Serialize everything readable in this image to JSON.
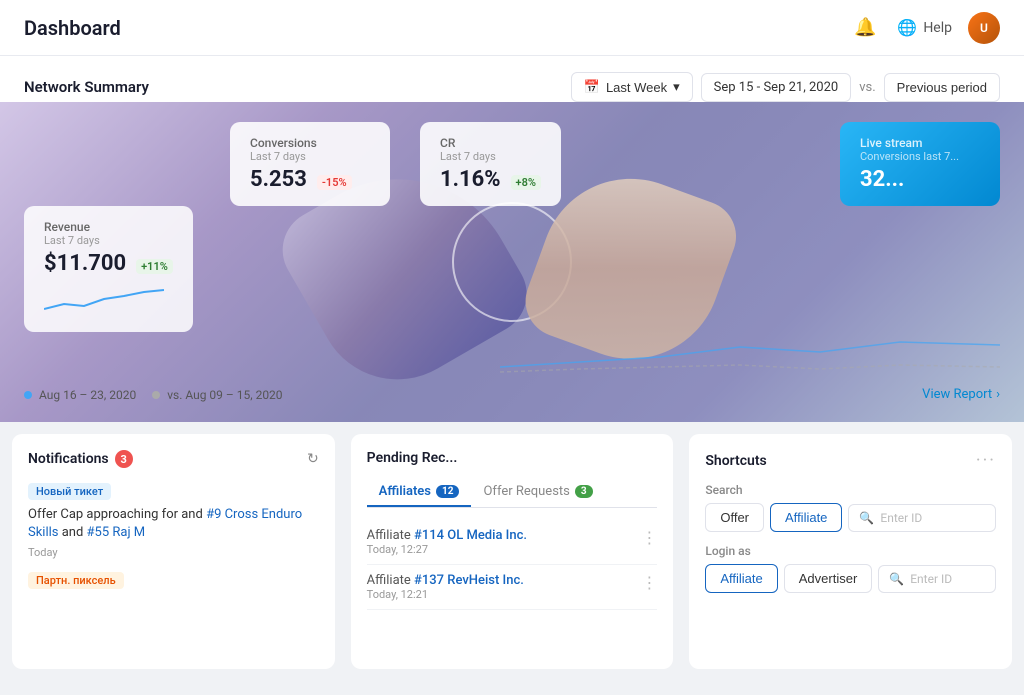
{
  "topbar": {
    "title": "Dashboard",
    "help_label": "Help"
  },
  "network_summary": {
    "title": "Network Summary",
    "date_range_label": "Last Week",
    "date_range": "Sep 15 - Sep 21, 2020",
    "vs_label": "vs.",
    "previous_period_label": "Previous period"
  },
  "stats": {
    "conversions": {
      "label": "Conversions",
      "period": "Last 7 days",
      "value": "5.253",
      "badge": "-15%",
      "badge_type": "negative"
    },
    "cr": {
      "label": "CR",
      "period": "Last 7 days",
      "value": "1.16%",
      "badge": "+8%",
      "badge_type": "positive"
    },
    "revenue": {
      "label": "Revenue",
      "period": "Last 7 days",
      "value": "$11.700",
      "badge": "+11%",
      "badge_type": "positive"
    },
    "live_stream": {
      "label": "Live stream",
      "period": "Conversions last 7...",
      "value": "32..."
    }
  },
  "legend": {
    "period1": "Aug 16 – 23, 2020",
    "period2": "vs. Aug 09 – 15, 2020"
  },
  "view_report": "View Report",
  "notifications": {
    "title": "Notifications",
    "count": "3",
    "items": [
      {
        "tag": "Новый тикет",
        "tag_type": "blue",
        "text": "Offer Cap approaching for and",
        "link_text": "#9 Cross Enduro Skills",
        "link2_text": "#55 Raj M",
        "time": "Today"
      },
      {
        "tag": "Партн. пиксель",
        "tag_type": "orange"
      }
    ]
  },
  "pending_requests": {
    "title": "Pending Rec...",
    "tabs": [
      {
        "label": "Affiliates",
        "count": "12",
        "active": true
      },
      {
        "label": "Offer Requests",
        "count": "3",
        "active": false
      }
    ],
    "items": [
      {
        "label": "Affiliate",
        "link": "#114 OL Media Inc.",
        "time": "Today, 12:27"
      },
      {
        "label": "Affiliate",
        "link": "#137 RevHeist Inc.",
        "time": "Today, 12:21"
      }
    ]
  },
  "shortcuts": {
    "title": "Shortcuts",
    "search_section": {
      "label": "Search",
      "offer_btn": "Offer",
      "affiliate_btn": "Affiliate",
      "placeholder": "Enter ID"
    },
    "login_section": {
      "label": "Login as",
      "affiliate_btn": "Affiliate",
      "advertiser_btn": "Advertiser",
      "placeholder": "Enter ID"
    }
  }
}
